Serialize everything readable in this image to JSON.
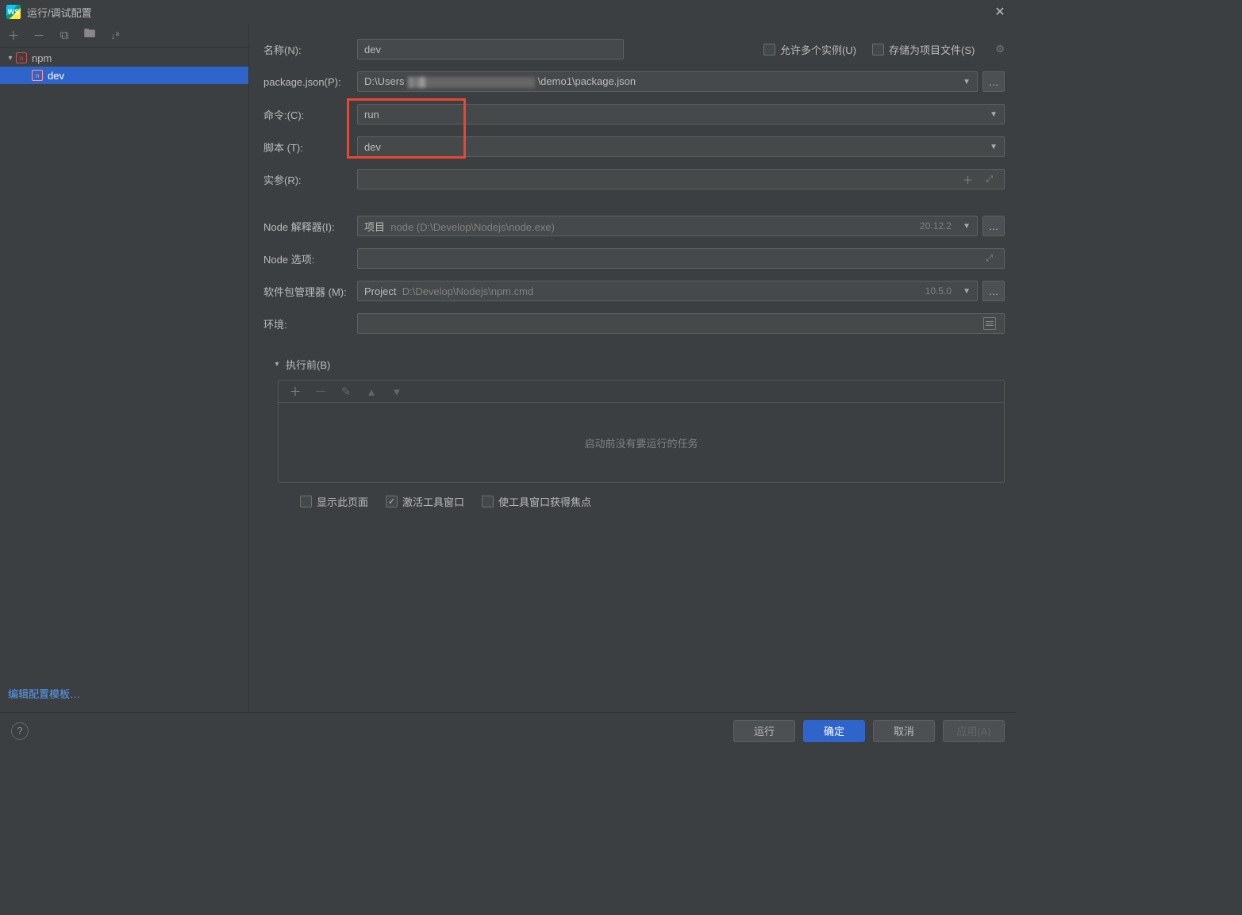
{
  "titlebar": {
    "title": "运行/调试配置"
  },
  "sidebar": {
    "tree": {
      "root_label": "npm",
      "child_label": "dev"
    },
    "edit_templates": "编辑配置模板…"
  },
  "form": {
    "name_label": "名称(N):",
    "name_value": "dev",
    "allow_multiple": "允许多个实例(U)",
    "store_as_project": "存储为项目文件(S)",
    "package_json_label": "package.json(P):",
    "package_json_value_a": "D:\\Users",
    "package_json_value_b": "\\demo1\\package.json",
    "command_label": "命令:(C):",
    "command_value": "run",
    "script_label": "脚本 (T):",
    "script_value": "dev",
    "args_label": "实参(R):",
    "node_interpreter_label": "Node 解释器(I):",
    "node_interpreter_prefix": "项目",
    "node_interpreter_path": "node (D:\\Develop\\Nodejs\\node.exe)",
    "node_interpreter_version": "20.12.2",
    "node_options_label": "Node 选项:",
    "pkg_manager_label": "软件包管理器 (M):",
    "pkg_manager_prefix": "Project",
    "pkg_manager_path": "D:\\Develop\\Nodejs\\npm.cmd",
    "pkg_manager_version": "10.5.0",
    "env_label": "环境:"
  },
  "before_launch": {
    "header": "执行前(B)",
    "empty": "启动前没有要运行的任务",
    "show_page": "显示此页面",
    "activate_tool_window": "激活工具窗口",
    "focus_tool_window": "使工具窗口获得焦点"
  },
  "footer": {
    "run": "运行",
    "ok": "确定",
    "cancel": "取消",
    "apply": "应用(A)"
  }
}
